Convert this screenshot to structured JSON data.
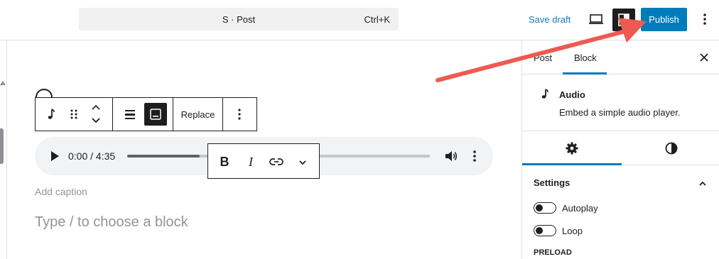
{
  "header": {
    "command_title": "S · Post",
    "command_shortcut": "Ctrl+K",
    "save_draft": "Save draft",
    "publish": "Publish",
    "icons": [
      "preview-desktop-icon",
      "settings-sidebar-icon",
      "more-vertical-icon"
    ]
  },
  "block_toolbar": {
    "replace_label": "Replace",
    "icons": [
      "audio-icon",
      "drag-handle-icon",
      "move-up-icon",
      "move-down-icon",
      "align-icon",
      "caption-icon",
      "more-options-icon"
    ]
  },
  "audio_player": {
    "time": "0:00 / 4:35",
    "progress": 0.24
  },
  "format_toolbar": {
    "bold": "B",
    "italic": "I",
    "icons": [
      "link-icon",
      "chevron-down-icon"
    ]
  },
  "editor": {
    "caption_placeholder": "Add caption",
    "block_placeholder": "Type / to choose a block"
  },
  "sidebar": {
    "tabs": [
      {
        "label": "Post",
        "active": false
      },
      {
        "label": "Block",
        "active": true
      }
    ],
    "block_name": "Audio",
    "block_description": "Embed a simple audio player.",
    "subtabs": [
      "settings-gear-icon",
      "styles-contrast-icon"
    ],
    "settings_title": "Settings",
    "toggles": [
      {
        "label": "Autoplay",
        "on": false
      },
      {
        "label": "Loop",
        "on": false
      }
    ],
    "preload_label": "PRELOAD"
  },
  "colors": {
    "accent": "#007cba",
    "save_draft": "#1a7aba",
    "annotation_arrow": "#ee5a52"
  }
}
